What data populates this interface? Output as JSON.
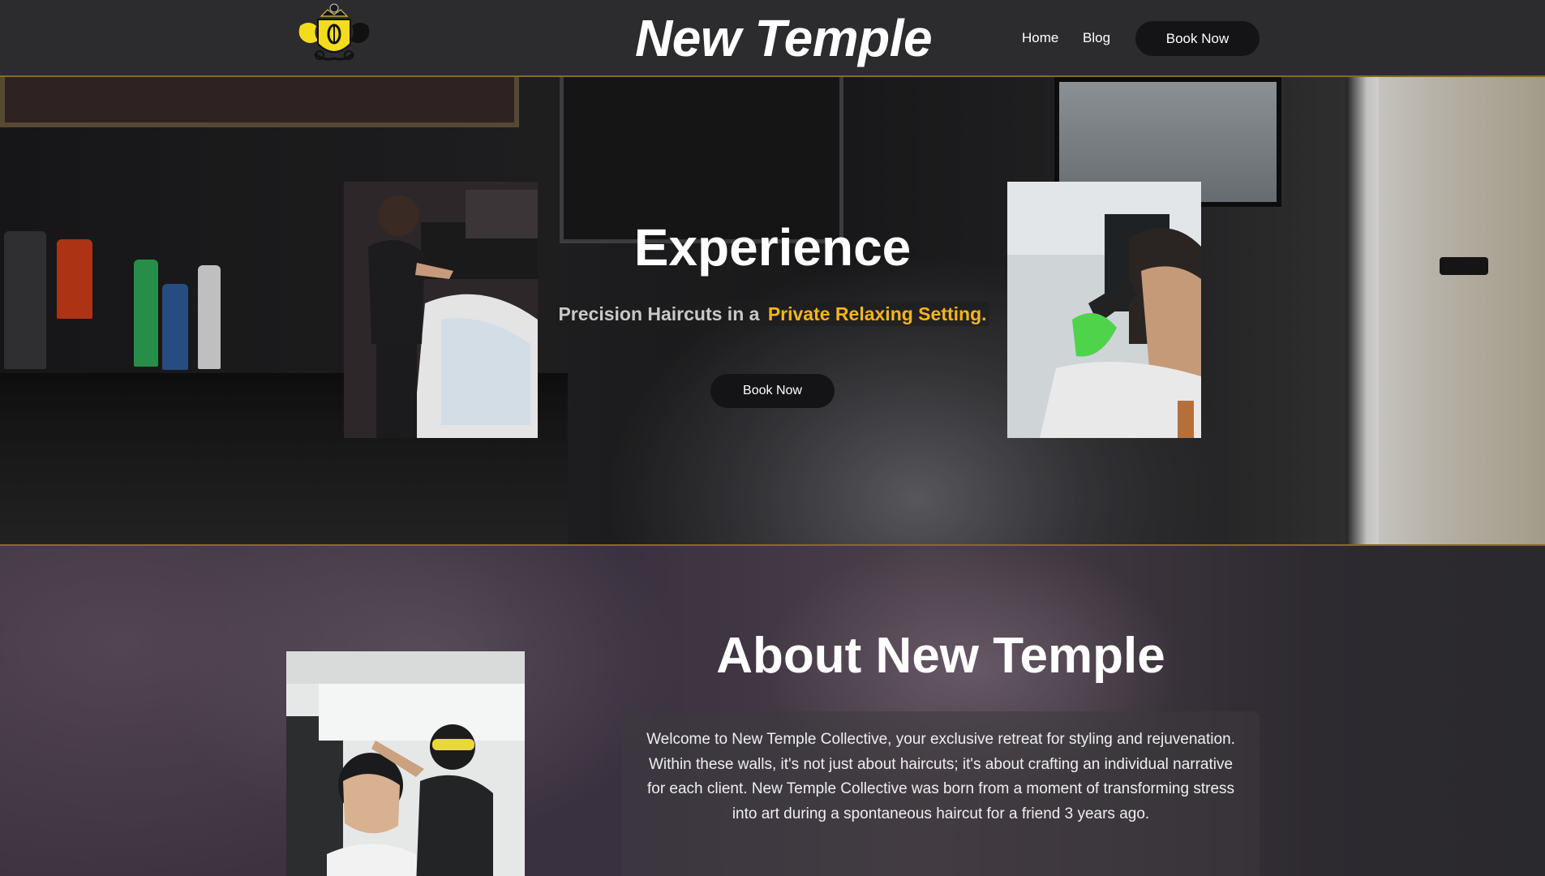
{
  "header": {
    "site_title": "New Temple",
    "nav": {
      "home": "Home",
      "blog": "Blog",
      "book_now": "Book Now"
    },
    "logo_icon": "lion-crest-logo-icon"
  },
  "hero": {
    "title": "Experience",
    "subtitle_plain": "Precision Haircuts in a ",
    "subtitle_highlight": "Private Relaxing Setting.",
    "book_now": "Book Now"
  },
  "about": {
    "title": "About New Temple",
    "body": "Welcome to New Temple Collective, your exclusive retreat for styling and rejuvenation. Within these walls, it's not just about haircuts; it's about crafting an individual narrative for each client. New Temple Collective was born from a moment of transforming stress into art during a spontaneous haircut for a friend 3 years ago."
  },
  "colors": {
    "header_bg": "#2c2c2e",
    "accent_gold": "#f5b51a",
    "divider_gold": "#8a6a1e",
    "button_bg": "#141416"
  }
}
